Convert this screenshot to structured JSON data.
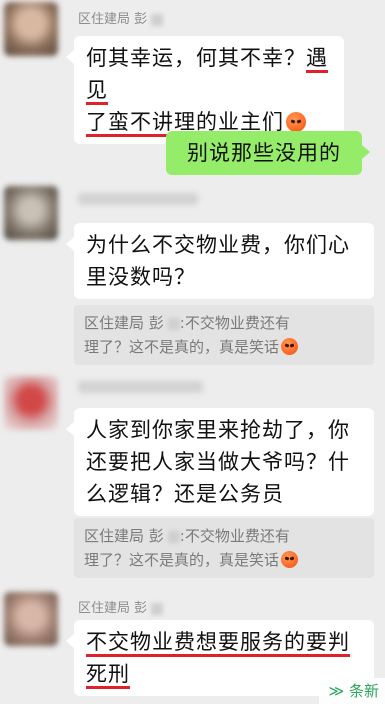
{
  "messages": [
    {
      "sender": "区住建局 彭",
      "lines": [
        "何其幸运，何其不幸？",
        "遇见",
        "了蛮不讲理的业主们"
      ]
    },
    {
      "text": "别说那些没用的"
    },
    {
      "lines": [
        "为什么不交物业费，你们心",
        "里没数吗？"
      ]
    },
    {
      "quote_lines": [
        "区住建局 彭",
        ":不交物业费还有",
        "理了？这不是真的，真是笑话"
      ]
    },
    {
      "lines": [
        "人家到你家里来抢劫了，你",
        "还要把人家当做大爷吗？什",
        "么逻辑？还是公务员"
      ]
    },
    {
      "quote_lines": [
        "区住建局 彭",
        ":不交物业费还有",
        "理了？这不是真的，真是笑话"
      ]
    },
    {
      "sender": "区住建局 彭",
      "lines": [
        "不交物业费想要服务的要判",
        "死刑"
      ]
    }
  ],
  "watermark": {
    "text": "条新"
  },
  "colors": {
    "background": "#ededed",
    "own_bubble": "#95ec69",
    "highlight": "#e0202a"
  }
}
